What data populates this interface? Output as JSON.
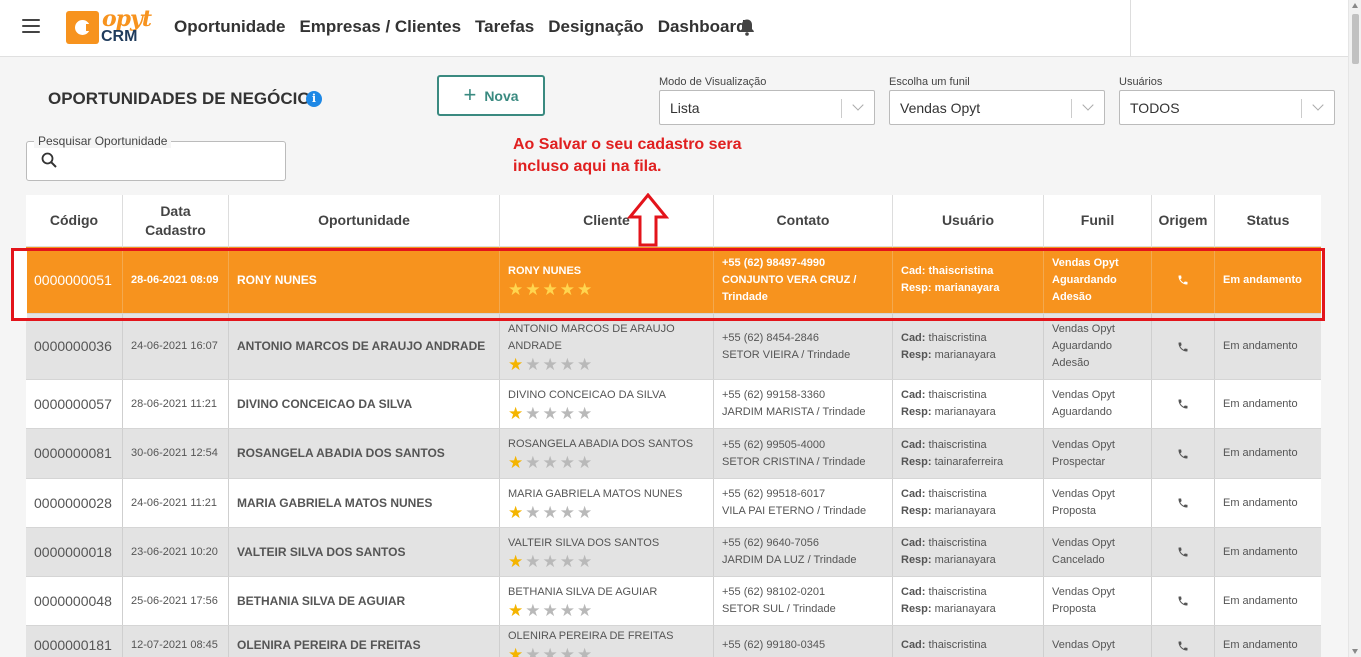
{
  "nav": {
    "logo_text": "opyt",
    "logo_sub": "CRM",
    "items": [
      "Oportunidade",
      "Empresas / Clientes",
      "Tarefas",
      "Designação",
      "Dashboard"
    ]
  },
  "page": {
    "title": "OPORTUNIDADES DE NEGÓCIO",
    "info_icon": "i",
    "new_button": "Nova"
  },
  "filters": {
    "view_mode": {
      "label": "Modo de Visualização",
      "value": "Lista"
    },
    "funnel": {
      "label": "Escolha um funil",
      "value": "Vendas Opyt"
    },
    "users": {
      "label": "Usuários",
      "value": "TODOS"
    }
  },
  "search": {
    "label": "Pesquisar Oportunidade",
    "placeholder": ""
  },
  "annotation": {
    "line1": "Ao Salvar o seu cadastro sera",
    "line2": "incluso aqui na fila."
  },
  "colors": {
    "accent": "#f7931e",
    "teal": "#3a8a80",
    "annotation_red": "#e3141b",
    "star": "#f4b400"
  },
  "table": {
    "headers": {
      "codigo": "Código",
      "data_line1": "Data",
      "data_line2": "Cadastro",
      "oportunidade": "Oportunidade",
      "cliente": "Cliente",
      "contato": "Contato",
      "usuario": "Usuário",
      "funil": "Funil",
      "origem": "Origem",
      "status": "Status"
    },
    "cad_label": "Cad:",
    "resp_label": "Resp:",
    "rows": [
      {
        "code": "0000000051",
        "date": "28-06-2021 08:09",
        "opp": "RONY NUNES",
        "client": "RONY NUNES",
        "stars": 5,
        "phone": "+55 (62) 98497-4990",
        "address": "CONJUNTO VERA CRUZ / Trindade",
        "cad": "thaiscristina",
        "resp": "marianayara",
        "funnel": "Vendas Opyt",
        "stage": "Aguardando Adesão",
        "origin_icon": "phone-icon",
        "status": "Em andamento"
      },
      {
        "code": "0000000036",
        "date": "24-06-2021 16:07",
        "opp": "ANTONIO MARCOS DE ARAUJO ANDRADE",
        "client": "ANTONIO MARCOS DE ARAUJO ANDRADE",
        "stars": 1,
        "phone": "+55 (62) 8454-2846",
        "address": "SETOR VIEIRA / Trindade",
        "cad": "thaiscristina",
        "resp": "marianayara",
        "funnel": "Vendas Opyt",
        "stage": "Aguardando Adesão",
        "origin_icon": "phone-icon",
        "status": "Em andamento"
      },
      {
        "code": "0000000057",
        "date": "28-06-2021 11:21",
        "opp": "DIVINO CONCEICAO DA SILVA",
        "client": "DIVINO CONCEICAO DA SILVA",
        "stars": 1,
        "phone": "+55 (62) 99158-3360",
        "address": "JARDIM MARISTA / Trindade",
        "cad": "thaiscristina",
        "resp": "marianayara",
        "funnel": "Vendas Opyt",
        "stage": "Aguardando",
        "origin_icon": "phone-icon",
        "status": "Em andamento"
      },
      {
        "code": "0000000081",
        "date": "30-06-2021 12:54",
        "opp": "ROSANGELA ABADIA DOS SANTOS",
        "client": "ROSANGELA ABADIA DOS SANTOS",
        "stars": 1,
        "phone": "+55 (62) 99505-4000",
        "address": "SETOR CRISTINA / Trindade",
        "cad": "thaiscristina",
        "resp": "tainaraferreira",
        "funnel": "Vendas Opyt",
        "stage": "Prospectar",
        "origin_icon": "phone-icon",
        "status": "Em andamento"
      },
      {
        "code": "0000000028",
        "date": "24-06-2021 11:21",
        "opp": "MARIA GABRIELA MATOS NUNES",
        "client": "MARIA GABRIELA MATOS NUNES",
        "stars": 1,
        "phone": "+55 (62) 99518-6017",
        "address": "VILA PAI ETERNO / Trindade",
        "cad": "thaiscristina",
        "resp": "marianayara",
        "funnel": "Vendas Opyt",
        "stage": "Proposta",
        "origin_icon": "phone-icon",
        "status": "Em andamento"
      },
      {
        "code": "0000000018",
        "date": "23-06-2021 10:20",
        "opp": "VALTEIR SILVA DOS SANTOS",
        "client": "VALTEIR SILVA DOS SANTOS",
        "stars": 1,
        "phone": "+55 (62) 9640-7056",
        "address": "JARDIM DA LUZ / Trindade",
        "cad": "thaiscristina",
        "resp": "marianayara",
        "funnel": "Vendas Opyt",
        "stage": "Cancelado",
        "origin_icon": "phone-icon",
        "status": "Em andamento"
      },
      {
        "code": "0000000048",
        "date": "25-06-2021 17:56",
        "opp": "BETHANIA SILVA DE AGUIAR",
        "client": "BETHANIA SILVA DE AGUIAR",
        "stars": 1,
        "phone": "+55 (62) 98102-0201",
        "address": "SETOR SUL / Trindade",
        "cad": "thaiscristina",
        "resp": "marianayara",
        "funnel": "Vendas Opyt",
        "stage": "Proposta",
        "origin_icon": "phone-icon",
        "status": "Em andamento"
      },
      {
        "code": "0000000181",
        "date": "12-07-2021 08:45",
        "opp": "OLENIRA PEREIRA DE FREITAS",
        "client": "OLENIRA PEREIRA DE FREITAS",
        "stars": 1,
        "phone": "+55 (62) 99180-0345",
        "address": "",
        "cad": "thaiscristina",
        "resp": "",
        "funnel": "Vendas Opyt",
        "stage": "",
        "origin_icon": "phone-icon",
        "status": "Em andamento"
      }
    ]
  }
}
